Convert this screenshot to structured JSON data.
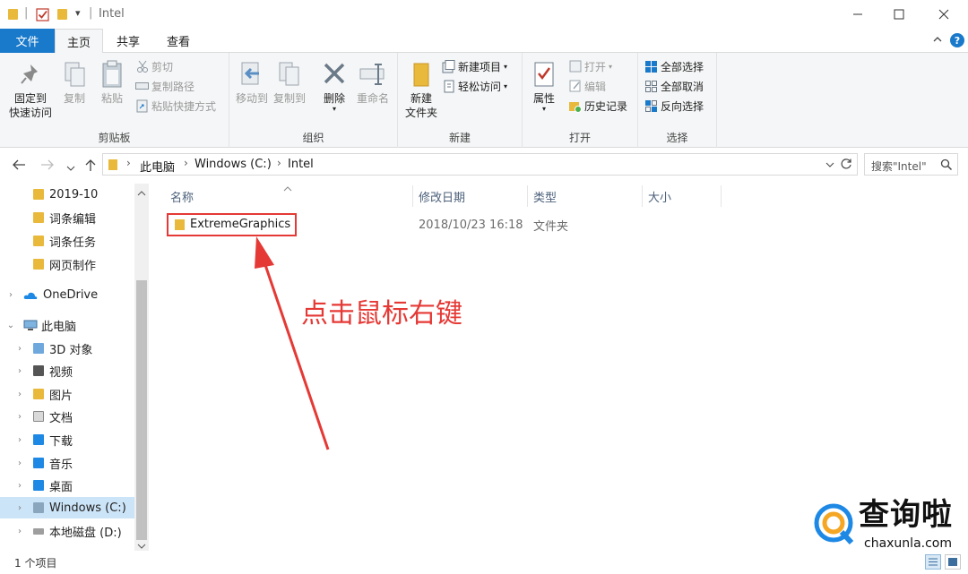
{
  "window": {
    "title": "Intel",
    "qat_dropdown": "▾"
  },
  "tabs": [
    {
      "label": "文件"
    },
    {
      "label": "主页"
    },
    {
      "label": "共享"
    },
    {
      "label": "查看"
    }
  ],
  "ribbon": {
    "clipboard": {
      "label": "剪贴板",
      "pin": "固定到\n快速访问",
      "copy": "复制",
      "paste": "粘贴",
      "cut": "剪切",
      "copy_path": "复制路径",
      "paste_shortcut": "粘贴快捷方式"
    },
    "organize": {
      "label": "组织",
      "move_to": "移动到",
      "copy_to": "复制到",
      "delete": "删除",
      "rename": "重命名"
    },
    "new": {
      "label": "新建",
      "new_folder": "新建\n文件夹",
      "new_item": "新建项目",
      "easy_access": "轻松访问"
    },
    "open": {
      "label": "打开",
      "properties": "属性",
      "open": "打开",
      "edit": "编辑",
      "history": "历史记录"
    },
    "select": {
      "label": "选择",
      "select_all": "全部选择",
      "select_none": "全部取消",
      "invert": "反向选择"
    }
  },
  "address": {
    "crumbs": [
      "此电脑",
      "Windows (C:)",
      "Intel"
    ],
    "search_placeholder": "搜索\"Intel\""
  },
  "nav_pane": {
    "items": [
      {
        "label": "2019-10"
      },
      {
        "label": "词条编辑"
      },
      {
        "label": "词条任务"
      },
      {
        "label": "网页制作"
      },
      {
        "label": "OneDrive"
      },
      {
        "label": "此电脑"
      },
      {
        "label": "3D 对象"
      },
      {
        "label": "视频"
      },
      {
        "label": "图片"
      },
      {
        "label": "文档"
      },
      {
        "label": "下载"
      },
      {
        "label": "音乐"
      },
      {
        "label": "桌面"
      },
      {
        "label": "Windows (C:)"
      },
      {
        "label": "本地磁盘 (D:)"
      }
    ]
  },
  "columns": {
    "name": "名称",
    "date": "修改日期",
    "type": "类型",
    "size": "大小"
  },
  "files": [
    {
      "name": "ExtremeGraphics",
      "date": "2018/10/23 16:18",
      "type": "文件夹",
      "size": ""
    }
  ],
  "annotation": {
    "text": "点击鼠标右键",
    "color": "#e53935"
  },
  "status": {
    "count": "1 个项目"
  },
  "watermark": {
    "brand": "查询啦",
    "domain": "chaxunla.com"
  },
  "colors": {
    "file_tab": "#1979ca",
    "folder": "#e8b93b",
    "highlight": "#e53935"
  }
}
